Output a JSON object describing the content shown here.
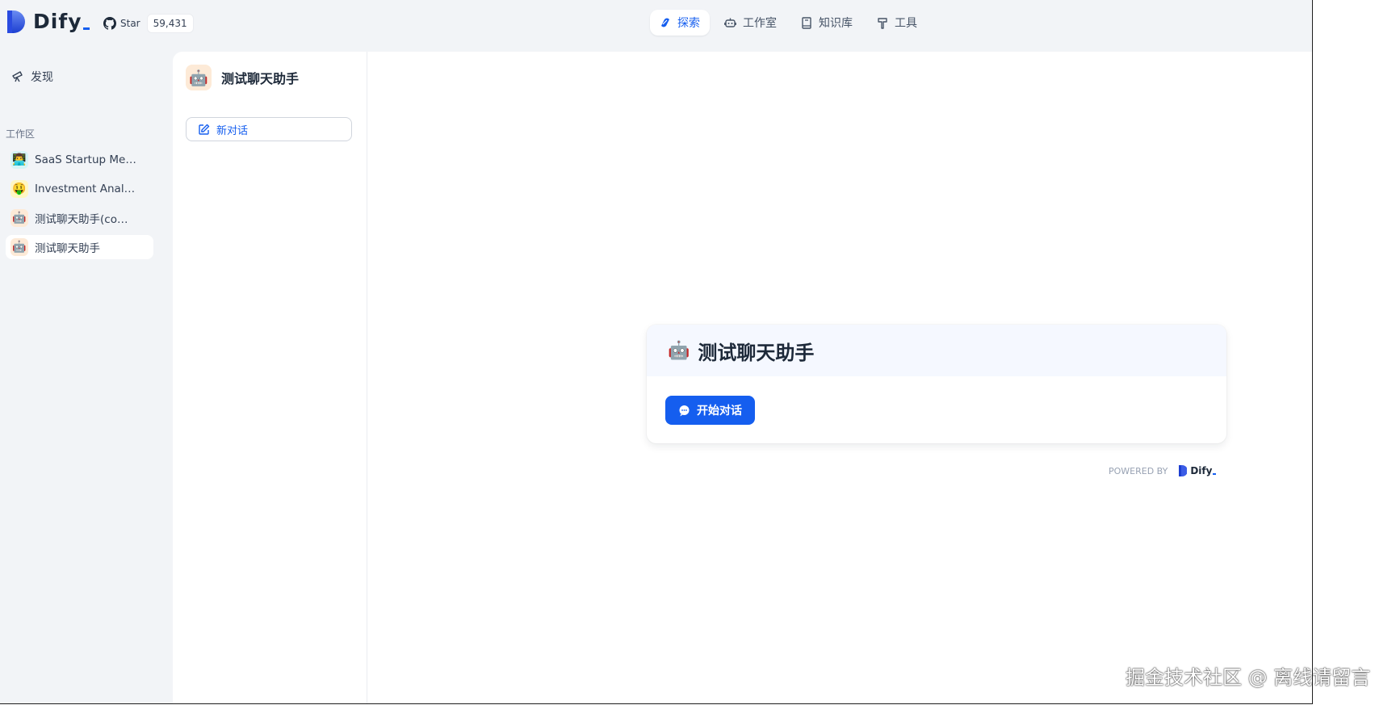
{
  "header": {
    "logo_text": "Dify",
    "github": {
      "label": "Star",
      "count": "59,431"
    },
    "nav": [
      {
        "label": "探索",
        "icon": "explore-icon",
        "active": true
      },
      {
        "label": "工作室",
        "icon": "robot-icon",
        "active": false
      },
      {
        "label": "知识库",
        "icon": "book-icon",
        "active": false
      },
      {
        "label": "工具",
        "icon": "hammer-icon",
        "active": false
      }
    ]
  },
  "sidebar": {
    "discover_label": "发现",
    "workspace_title": "工作区",
    "items": [
      {
        "label": "SaaS Startup Me…",
        "icon": "👨‍💻",
        "active": false
      },
      {
        "label": "Investment Anal…",
        "icon": "🤑",
        "active": false
      },
      {
        "label": "测试聊天助手(co…",
        "icon": "🤖",
        "active": false
      },
      {
        "label": "测试聊天助手",
        "icon": "🤖",
        "active": true
      }
    ]
  },
  "conversations": {
    "app_icon": "🤖",
    "app_title": "测试聊天助手",
    "new_chat_label": "新对话"
  },
  "main": {
    "card_emoji": "🤖",
    "card_title": "测试聊天助手",
    "start_button_label": "开始对话",
    "powered_by": "POWERED BY",
    "powered_logo": "Dify"
  },
  "watermark": "掘金技术社区 @ 离线请留言",
  "colors": {
    "accent": "#155eef",
    "bg": "#f2f4f7",
    "card_head": "#f5f8ff"
  }
}
